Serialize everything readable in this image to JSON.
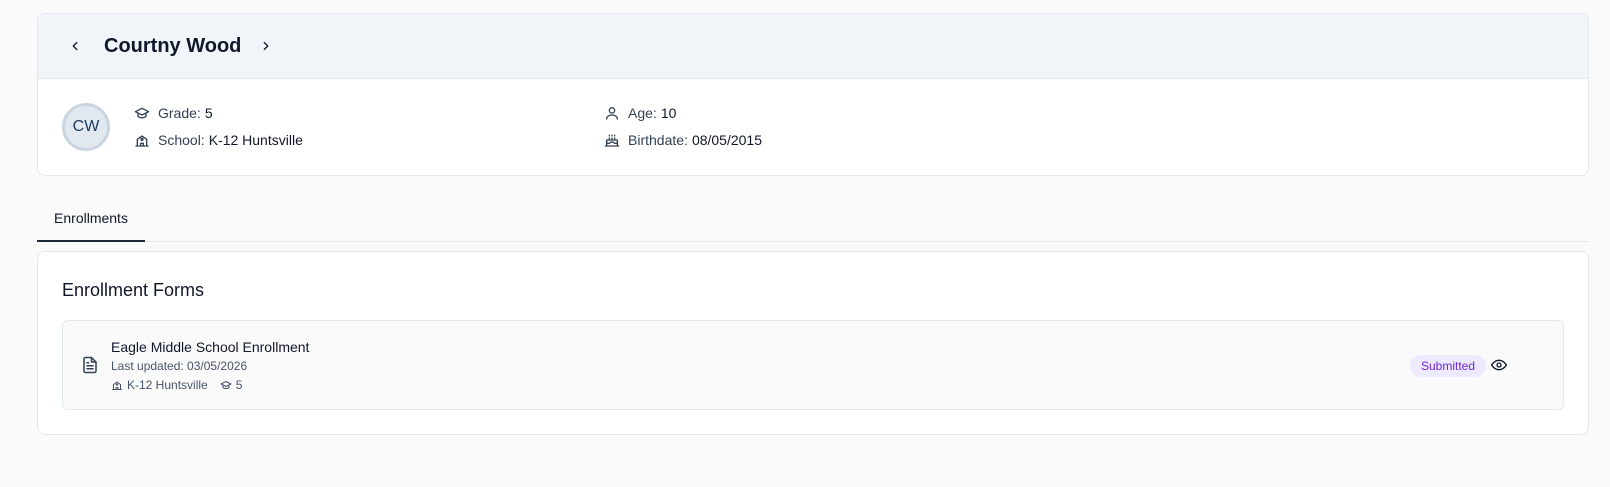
{
  "student": {
    "name": "Courtny Wood",
    "initials": "CW",
    "grade_label": "Grade:",
    "grade": "5",
    "school_label": "School:",
    "school": "K-12 Huntsville",
    "age_label": "Age:",
    "age": "10",
    "birthdate_label": "Birthdate:",
    "birthdate": "08/05/2015"
  },
  "tabs": [
    {
      "label": "Enrollments",
      "active": true
    }
  ],
  "forms_section": {
    "title": "Enrollment Forms",
    "items": [
      {
        "name": "Eagle Middle School Enrollment",
        "updated": "Last updated: 03/05/2026",
        "school": "K-12 Huntsville",
        "grade": "5",
        "status": "Submitted"
      }
    ]
  },
  "icons": {
    "prev": "chevron-left-icon",
    "next": "chevron-right-icon",
    "grade": "graduation-cap-icon",
    "school": "school-building-icon",
    "age": "user-icon",
    "birthdate": "cake-icon",
    "form": "file-text-icon",
    "view": "eye-icon"
  },
  "colors": {
    "header_bg": "#f1f5f9",
    "badge_bg": "#ede9fe",
    "badge_text": "#6d28d9",
    "tab_underline": "#1e293b"
  }
}
